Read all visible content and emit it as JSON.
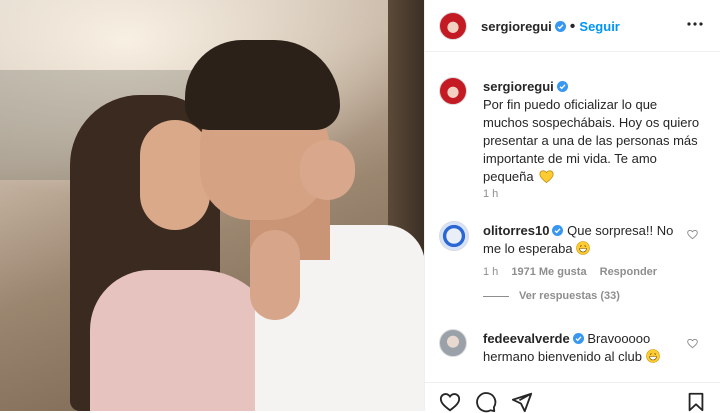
{
  "post": {
    "author": "sergioregui",
    "follow_label": "Seguir",
    "separator": "•"
  },
  "caption": {
    "author": "sergioregui",
    "text": "Por fin puedo oficializar lo que muchos sospechábais. Hoy os quiero presentar a una de las personas más importante de mi vida. Te amo pequeña",
    "emoji": "yellow-heart",
    "time": "1 h"
  },
  "comments": [
    {
      "author": "olitorres10",
      "text": "Que sorpresa!! No me lo esperaba",
      "emoji": "grinning-sweat-face",
      "time": "1 h",
      "likes": "1971 Me gusta",
      "reply_label": "Responder",
      "view_replies": "Ver respuestas (33)"
    },
    {
      "author": "fedeevalverde",
      "text": "Bravooooo hermano bienvenido al club",
      "emoji": "grinning-sweat-face"
    }
  ],
  "icons": {
    "verified": "verified-badge-icon",
    "more": "more-options-icon",
    "like": "heart-icon",
    "comment": "comment-icon",
    "share": "share-icon",
    "save": "bookmark-icon"
  },
  "colors": {
    "accent": "#0095f6",
    "text": "#262626",
    "muted": "#8e8e8e",
    "emoji_yellow": "#ffcc33"
  }
}
